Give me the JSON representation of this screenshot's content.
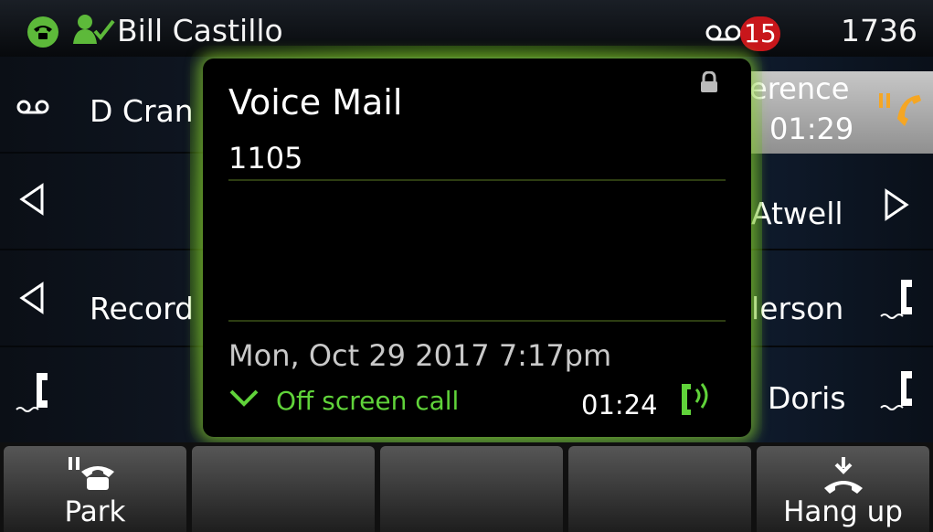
{
  "header": {
    "user_name": "Bill Castillo",
    "voicemail_count": "15",
    "extension": "1736"
  },
  "lines": [
    {
      "label": "D Cran",
      "icon": "voicemail-icon"
    },
    {
      "label": "",
      "icon": "left-arrow-icon"
    },
    {
      "label": "Record",
      "icon": "left-arrow-icon"
    },
    {
      "label": "",
      "icon": "handset-icon"
    }
  ],
  "right_lines": [
    {
      "label": "erence",
      "time": "01:29",
      "icon": "hold-call-icon"
    },
    {
      "label": "Atwell",
      "icon": "right-arrow-icon"
    },
    {
      "label": "lerson",
      "icon": "handset-icon"
    },
    {
      "label": "Doris",
      "icon": "handset-icon"
    }
  ],
  "popup": {
    "title": "Voice Mail",
    "number": "1105",
    "date": "Mon, Oct 29 2017 7:17pm",
    "off_screen": "Off screen call",
    "duration": "01:24"
  },
  "softkeys": [
    {
      "label": "Park",
      "icon": "park-icon"
    },
    {
      "label": ""
    },
    {
      "label": ""
    },
    {
      "label": ""
    },
    {
      "label": "Hang up",
      "icon": "hang-up-icon"
    }
  ],
  "colors": {
    "accent_green": "#5db93a",
    "badge_red": "#c8161b",
    "hold_orange": "#f5a623"
  }
}
